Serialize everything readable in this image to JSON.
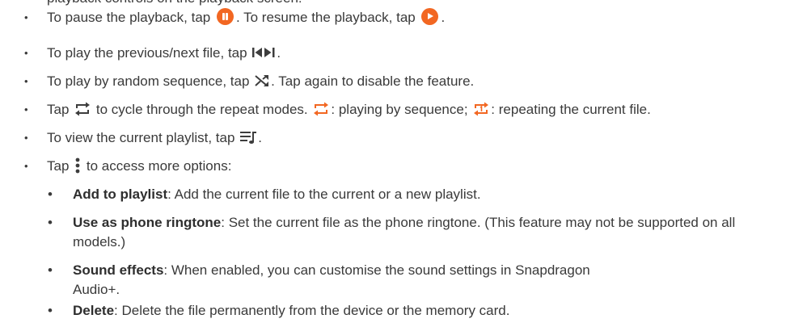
{
  "cutoff_text": "playback controls on the playback screen:",
  "items": [
    {
      "bullet": "•",
      "before": "To pause the playback, tap",
      "mid": ". To resume the playback, tap",
      "after": "."
    },
    {
      "bullet": "•",
      "before": "To play the previous/next file, tap",
      "after": "."
    },
    {
      "bullet": "•",
      "before": "To play by random sequence, tap",
      "after": ". Tap again to disable the feature."
    },
    {
      "bullet": "•",
      "before": "Tap",
      "mid1": "to cycle through the repeat modes.",
      "mid2": ": playing by sequence;",
      "after": ": repeating the current file."
    },
    {
      "bullet": "•",
      "before": "To view the current playlist, tap",
      "after": "."
    },
    {
      "bullet": "•",
      "before": "Tap",
      "after": "to access more options:"
    }
  ],
  "options": [
    {
      "bullet": "•",
      "term": "Add to playlist",
      "desc": ": Add the current file to the current or a new playlist."
    },
    {
      "bullet": "•",
      "term": "Use as phone ringtone",
      "desc": ": Set the current file as the phone ringtone. (This feature may not be supported on all models.)"
    },
    {
      "bullet": "•",
      "term": "Sound effects",
      "desc": ": When enabled, you can customise the sound settings in Snapdragon Audio+."
    },
    {
      "bullet": "•",
      "term": "Delete",
      "desc": ": Delete the file permanently from the device or the memory card."
    }
  ],
  "icons": {
    "pause": "pause-icon",
    "play": "play-icon",
    "prev_next": "previous-next-icon",
    "shuffle": "shuffle-icon",
    "repeat": "repeat-icon",
    "repeat_one": "repeat-one-icon",
    "playlist": "playlist-icon",
    "more": "more-options-icon"
  },
  "colors": {
    "accent": "#f26722",
    "text": "#3a3a3a",
    "icon": "#3d3d3d"
  }
}
